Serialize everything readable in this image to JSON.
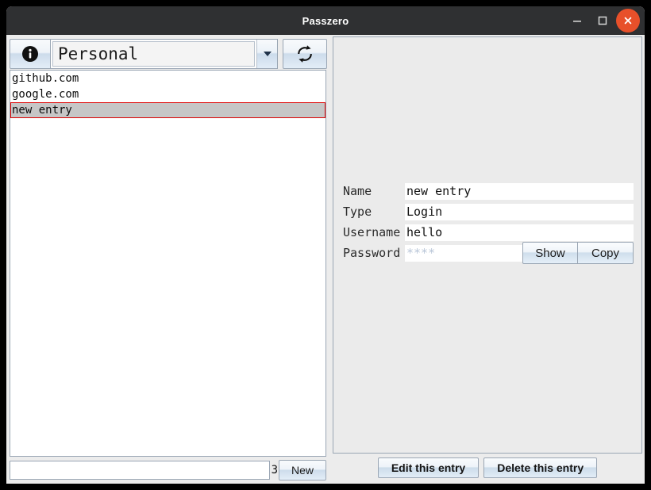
{
  "window": {
    "title": "Passzero",
    "controls": {
      "minimize": "minimize-icon",
      "maximize": "maximize-icon",
      "close": "close-icon"
    },
    "colors": {
      "titlebar_bg": "#2f3032",
      "close_button": "#e8502a",
      "panel_bg": "#ececec",
      "detail_bg": "#ebebeb",
      "selection_bg": "#c6c6c6",
      "selection_border": "#dd0000",
      "field_bg": "#ffffff",
      "masked_text": "#b9c6d8"
    }
  },
  "toolbar": {
    "info_icon": "info-icon",
    "refresh_icon": "refresh-icon",
    "vault_selector": {
      "value": "Personal",
      "arrow_icon": "chevron-down-icon"
    }
  },
  "entry_list": {
    "items": [
      {
        "label": "github.com",
        "selected": false
      },
      {
        "label": "google.com",
        "selected": false
      },
      {
        "label": "new entry",
        "selected": true
      }
    ]
  },
  "left_bottom": {
    "search": {
      "value": "",
      "placeholder": ""
    },
    "count": "3",
    "new_label": "New"
  },
  "detail": {
    "fields": [
      {
        "label": "Name",
        "value": "new entry",
        "masked": false
      },
      {
        "label": "Type",
        "value": "Login",
        "masked": false
      },
      {
        "label": "Username",
        "value": "hello",
        "masked": false
      },
      {
        "label": "Password",
        "value": "****",
        "masked": true
      }
    ],
    "show_label": "Show",
    "copy_label": "Copy"
  },
  "right_bottom": {
    "edit_label": "Edit this entry",
    "delete_label": "Delete this entry"
  }
}
